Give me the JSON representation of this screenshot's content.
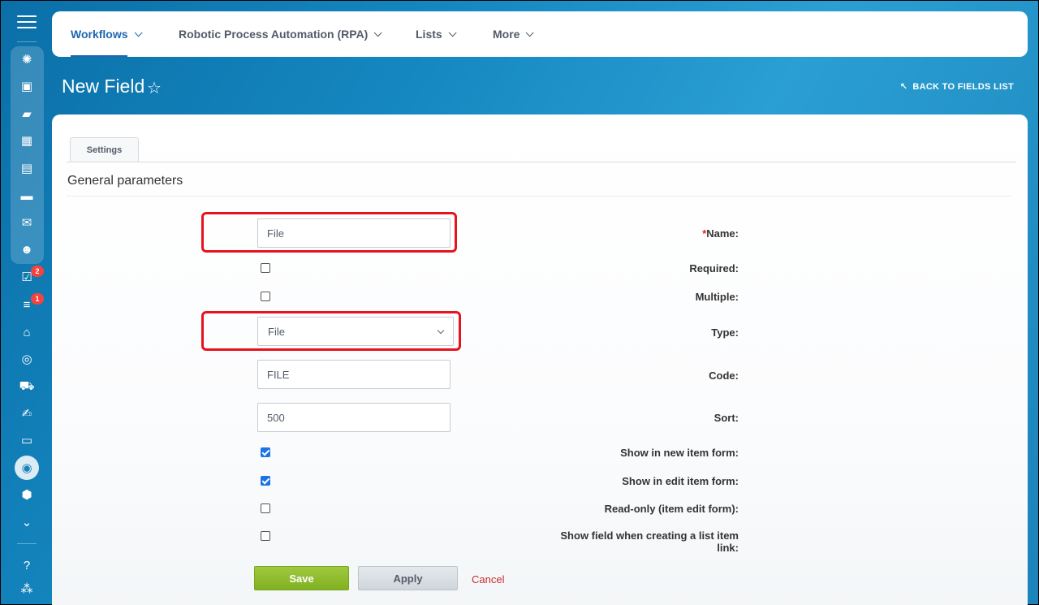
{
  "nav": {
    "items": [
      {
        "label": "Workflows"
      },
      {
        "label": "Robotic Process Automation (RPA)"
      },
      {
        "label": "Lists"
      },
      {
        "label": "More"
      }
    ]
  },
  "sidebar": {
    "badges": {
      "tasks": "2",
      "funnel": "1"
    }
  },
  "page": {
    "title": "New Field",
    "back_link": "BACK TO FIELDS LIST"
  },
  "tabs": [
    {
      "label": "Settings"
    }
  ],
  "section": {
    "title": "General parameters"
  },
  "form": {
    "name": {
      "label": "Name:",
      "required_mark": "*",
      "value": "File"
    },
    "required": {
      "label": "Required:",
      "checked": false
    },
    "multiple": {
      "label": "Multiple:",
      "checked": false
    },
    "type": {
      "label": "Type:",
      "value": "File"
    },
    "code": {
      "label": "Code:",
      "value": "FILE"
    },
    "sort": {
      "label": "Sort:",
      "value": "500"
    },
    "show_new": {
      "label": "Show in new item form:",
      "checked": true
    },
    "show_edit": {
      "label": "Show in edit item form:",
      "checked": true
    },
    "read_only": {
      "label": "Read-only (item edit form):",
      "checked": false
    },
    "show_link": {
      "label": "Show field when creating a list item link:",
      "checked": false
    }
  },
  "buttons": {
    "save": "Save",
    "apply": "Apply",
    "cancel": "Cancel"
  },
  "colors": {
    "accent": "#2067b0",
    "highlight": "#e8121d",
    "save": "#8bbb2a"
  }
}
